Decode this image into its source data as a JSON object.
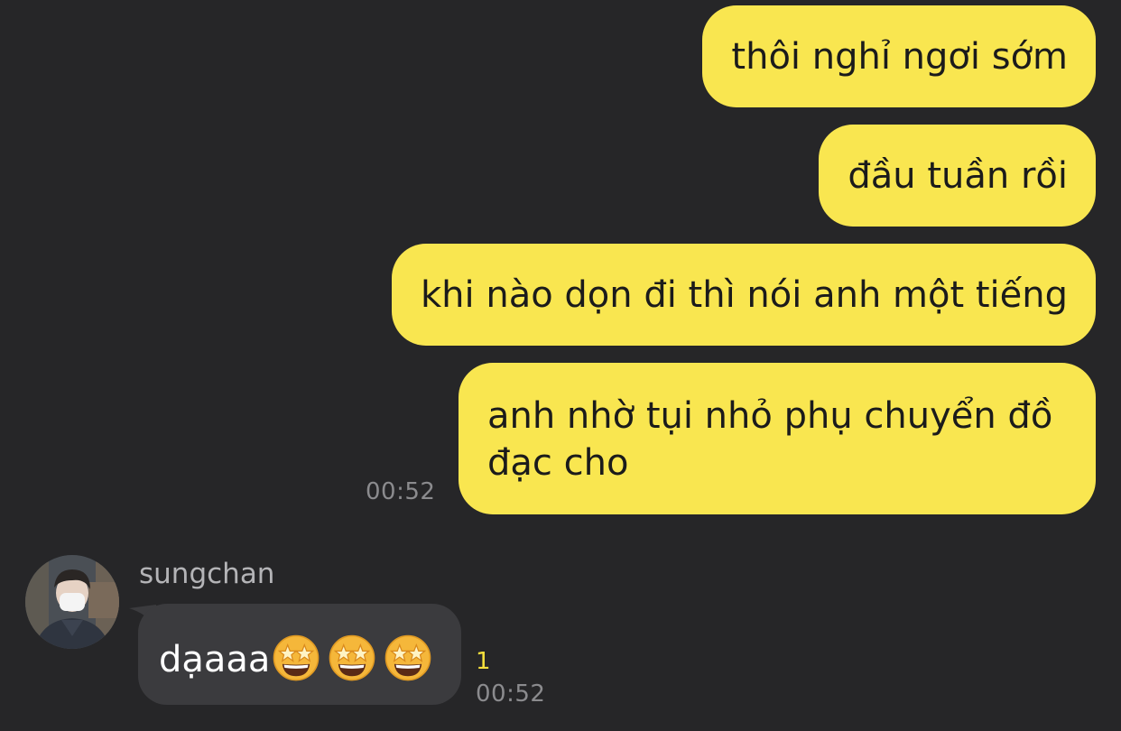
{
  "outgoing": {
    "messages": [
      "thôi nghỉ ngơi sớm",
      "đầu tuần rồi",
      "khi nào dọn đi thì nói anh một tiếng",
      "anh nhờ tụi nhỏ phụ chuyển đồ đạc cho"
    ],
    "time": "00:52",
    "bubble_color": "#f9e650"
  },
  "incoming": {
    "sender": "sungchan",
    "text": "dạaaa",
    "emoji": [
      "star-struck-emoji",
      "star-struck-emoji",
      "star-struck-emoji"
    ],
    "unread_count": "1",
    "time": "00:52",
    "bubble_color": "#3b3b3e"
  },
  "theme": {
    "background": "#262628",
    "unread_color": "#f5df3c"
  }
}
